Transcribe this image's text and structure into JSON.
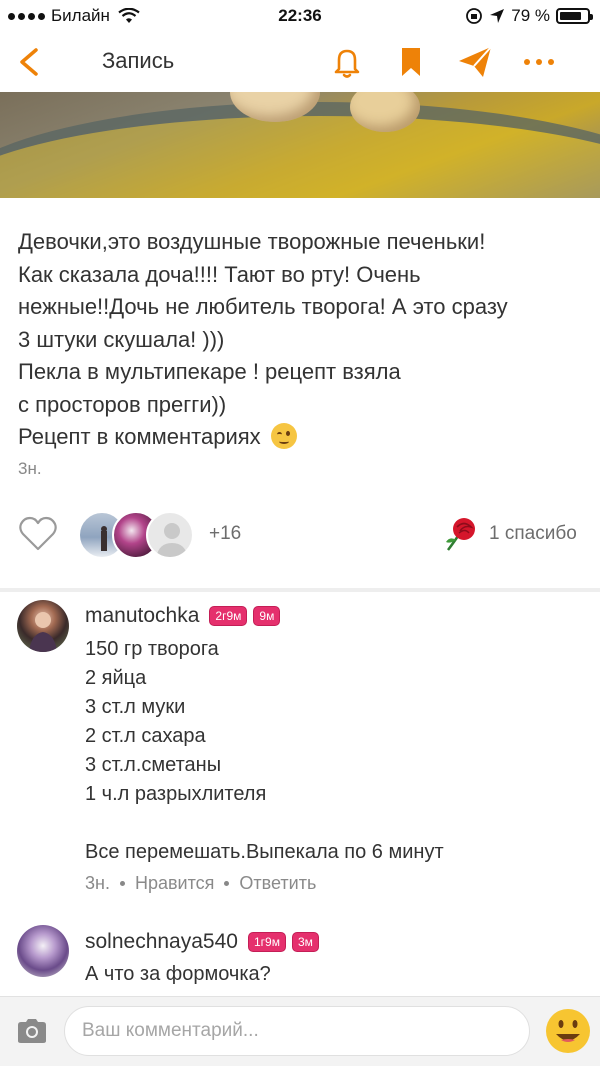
{
  "status_bar": {
    "carrier": "Билайн",
    "time": "22:36",
    "battery": "79 %",
    "battery_level": 0.79
  },
  "header": {
    "title": "Запись",
    "icons": [
      "back-chevron-icon",
      "bell-icon",
      "bookmark-icon",
      "send-icon",
      "more-icon"
    ],
    "accent_color": "#ee8208"
  },
  "post": {
    "text_lines": [
      "Девочки,это воздушные творожные печеньки!",
      "Как сказала доча!!!! Тают во рту! Очень",
      "нежные!!Дочь не любитель творога! А это сразу",
      "3 штуки скушала! )))",
      "Пекла в мультипекаре ! рецепт взяла",
      "с просторов прегги))",
      "Рецепт в комментариях"
    ],
    "time": "3н."
  },
  "reactions": {
    "likes_extra": "+16",
    "thanks": "1 спасибо"
  },
  "comments": [
    {
      "author": "manutochka",
      "badges": [
        "2г9м",
        "9м"
      ],
      "lines": [
        "150 гр творога",
        "2 яйца",
        "3 ст.л муки",
        "2 ст.л сахара",
        "3 ст.л.сметаны",
        "1 ч.л разрыхлителя",
        "",
        "Все перемешать.Выпекала по 6 минут"
      ],
      "time": "3н.",
      "like_label": "Нравится",
      "reply_label": "Ответить"
    },
    {
      "author": "solnechnaya540",
      "badges": [
        "1г9м",
        "3м"
      ],
      "lines": [
        "А что за формочка?"
      ]
    }
  ],
  "composer": {
    "placeholder": "Ваш комментарий..."
  }
}
